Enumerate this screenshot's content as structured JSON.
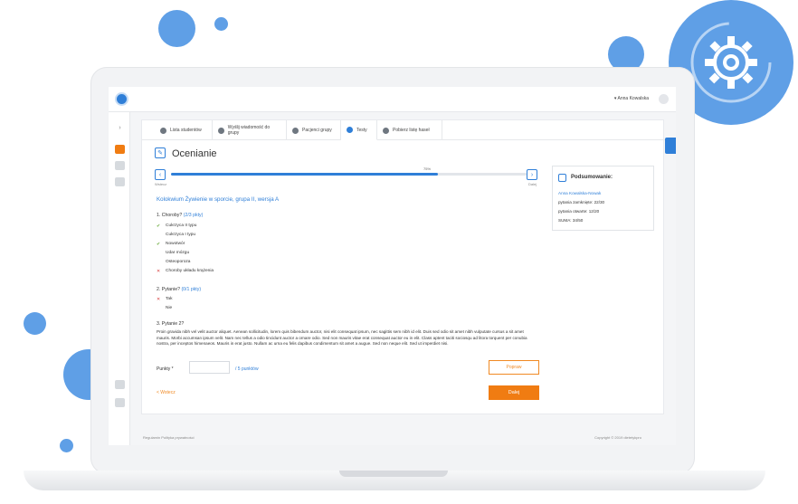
{
  "topbar": {
    "user_name": "Anna Kowalska"
  },
  "tabs": [
    {
      "label": "Lista studentów",
      "icon": "users-icon"
    },
    {
      "label": "Wyślij wiadomość do grupy",
      "icon": "mail-icon"
    },
    {
      "label": "Pacjenci grupy",
      "icon": "patients-icon"
    },
    {
      "label": "Testy",
      "icon": "test-icon"
    },
    {
      "label": "Pobierz listę haseł",
      "icon": "download-icon"
    }
  ],
  "page": {
    "title": "Ocenianie"
  },
  "nav": {
    "prev_label": "Wstecz",
    "next_label": "Dalej",
    "progress_percent": 75,
    "progress_label": "75%"
  },
  "test": {
    "title": "Kolokwium Żywienie w sporcie, grupa II, wersja A"
  },
  "questions": [
    {
      "number": "1.",
      "text": "Choroby?",
      "points": "(2/3 pkty)",
      "answers": [
        {
          "label": "Cukrzyca II typu",
          "mark": "✔"
        },
        {
          "label": "Cukrzyca I typu",
          "mark": ""
        },
        {
          "label": "Nowotwór",
          "mark": "✔"
        },
        {
          "label": "Udar mózgu",
          "mark": ""
        },
        {
          "label": "Osteoporoza",
          "mark": ""
        },
        {
          "label": "Choroby układu krążenia",
          "mark": "✕"
        }
      ]
    },
    {
      "number": "2.",
      "text": "Pytanie?",
      "points": "(0/1 pkty)",
      "answers": [
        {
          "label": "Tak",
          "mark": "✕"
        },
        {
          "label": "Nie",
          "mark": ""
        }
      ]
    },
    {
      "number": "3.",
      "text": "Pytanie 2?",
      "points": "",
      "answer_text": "Proin gravida nibh vel velit auctor aliquet. Aenean sollicitudin, lorem quis bibendum auctor, nisi elit consequat ipsum, nec sagittis sem nibh id elit. Duis sed odio sit amet nibh vulputate cursus a sit amet mauris. Morbi accumsan ipsum velit. Nam nec tellus a odio tincidunt auctor a ornare odio. Sed non mauris vitae erat consequat auctor eu in elit. Class aptent taciti sociosqu ad litora torquent per conubia nostra, per inceptos himenaeos. Mauris in erat justo. Nullam ac urna eu felis dapibus condimentum sit amet a augue. Sed non neque elit. Sed ut imperdiet nisi."
    }
  ],
  "grading": {
    "points_label": "Punkty *",
    "points_value": "",
    "points_of": "/ 5 punktów",
    "fix_button": "Popraw",
    "next_button": "Dalej",
    "back_link": "< Wstecz"
  },
  "summary": {
    "title": "Podsumowanie:",
    "student": "Anna Kowalska-Nowak",
    "closed": "pytania zamknięte: 22/30",
    "open": "pytania otwarte: 12/20",
    "total": "SUMA: 34/50"
  },
  "footer": {
    "left": "Regulamin    Polityka prywatności",
    "right": "Copyright © 2019 dietetykpro"
  },
  "colors": {
    "accent": "#2f7fd8",
    "orange": "#f07c12",
    "deco": "#5f9fe6"
  }
}
